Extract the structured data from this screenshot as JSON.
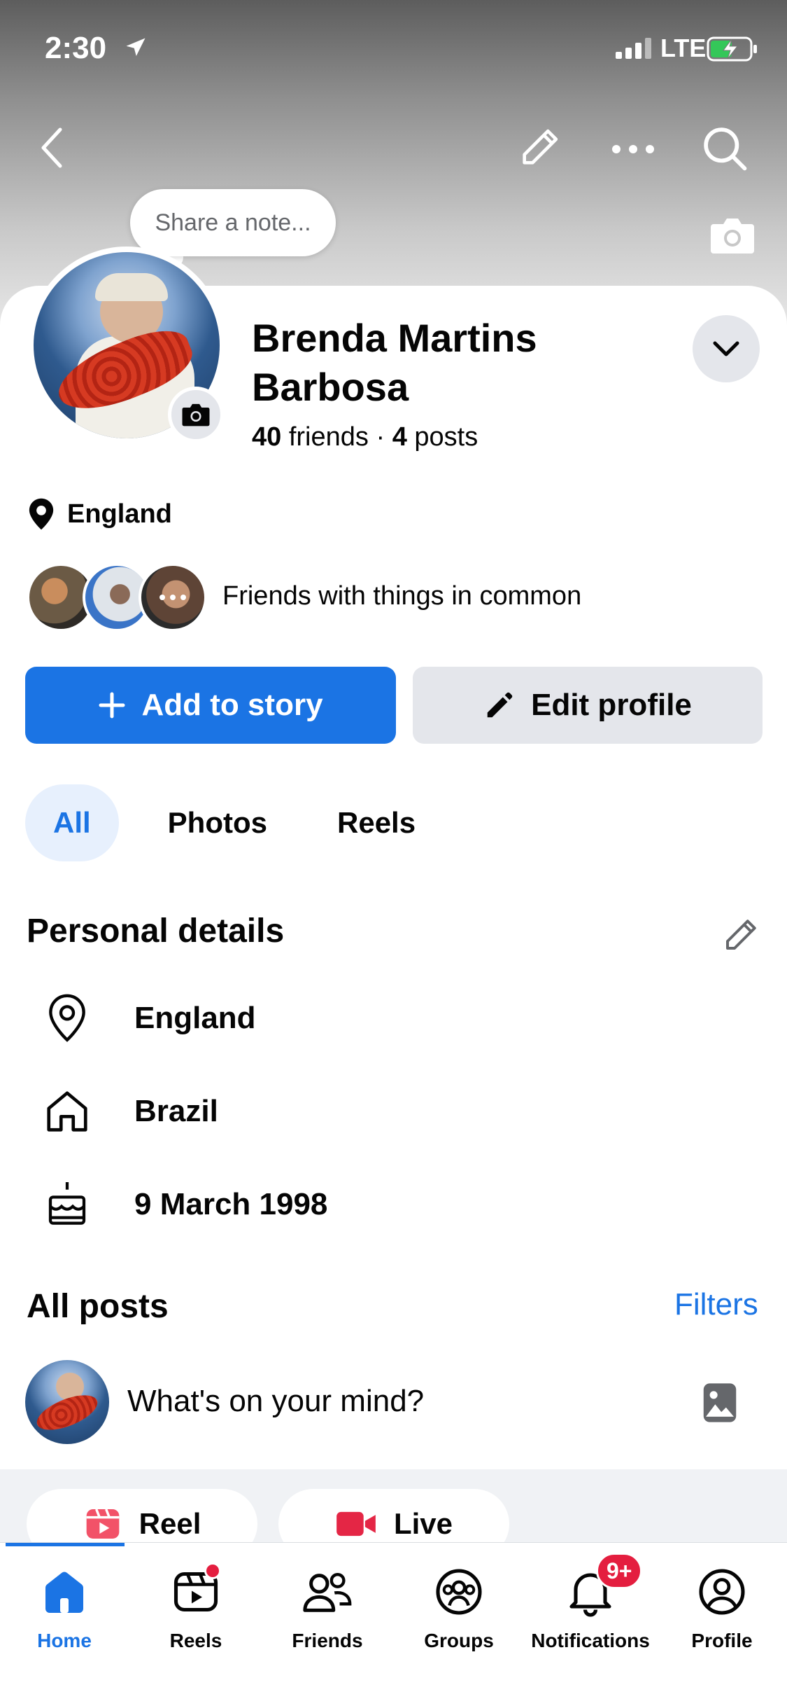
{
  "status_bar": {
    "time": "2:30",
    "network": "LTE"
  },
  "note": {
    "placeholder": "Share a note..."
  },
  "profile": {
    "name": "Brenda Martins Barbosa",
    "friends_count": "40",
    "friends_label": "friends",
    "posts_count": "4",
    "posts_label": "posts",
    "location": "England",
    "mutual_text": "Friends with things in common"
  },
  "actions": {
    "add_story": "Add to story",
    "edit_profile": "Edit profile"
  },
  "tabs": [
    {
      "label": "All",
      "active": true
    },
    {
      "label": "Photos",
      "active": false
    },
    {
      "label": "Reels",
      "active": false
    }
  ],
  "personal_details": {
    "title": "Personal details",
    "items": [
      {
        "icon": "location-pin-icon",
        "value": "England"
      },
      {
        "icon": "home-icon",
        "value": "Brazil"
      },
      {
        "icon": "birthday-cake-icon",
        "value": "9 March 1998"
      }
    ]
  },
  "posts": {
    "title": "All posts",
    "filters": "Filters",
    "composer_placeholder": "What's on your mind?",
    "reel_label": "Reel",
    "live_label": "Live"
  },
  "tabbar": {
    "items": [
      {
        "label": "Home",
        "icon": "home-icon",
        "active": true
      },
      {
        "label": "Reels",
        "icon": "reels-icon",
        "active": false
      },
      {
        "label": "Friends",
        "icon": "friends-icon",
        "active": false
      },
      {
        "label": "Groups",
        "icon": "groups-icon",
        "active": false
      },
      {
        "label": "Notifications",
        "icon": "bell-icon",
        "active": false,
        "badge": "9+"
      },
      {
        "label": "Profile",
        "icon": "profile-icon",
        "active": false
      }
    ]
  },
  "colors": {
    "accent": "#1b74e4",
    "badge": "#e41e3f",
    "chip_bg": "#e4e6eb"
  }
}
